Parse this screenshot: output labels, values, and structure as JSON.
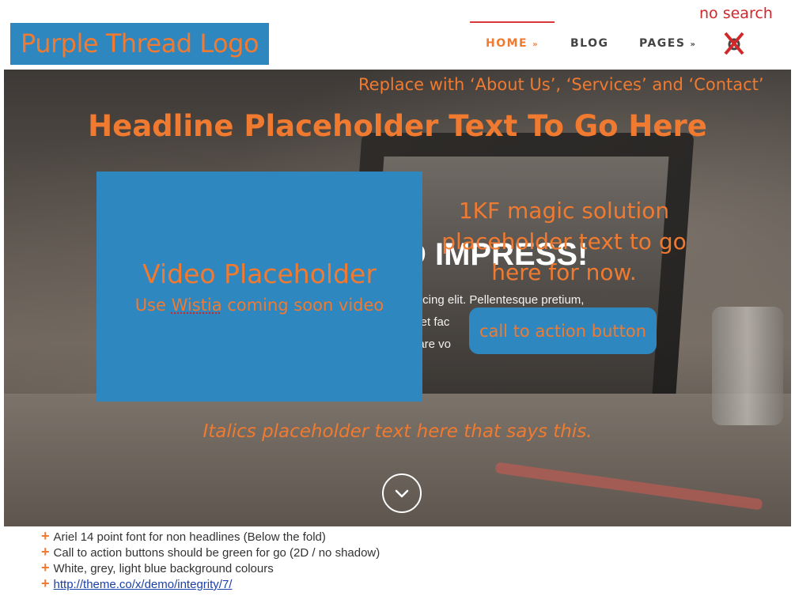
{
  "header": {
    "logo_text": "Purple Thread Logo",
    "nav": [
      {
        "label": "HOME",
        "chevron": "»",
        "active": true
      },
      {
        "label": "BLOG",
        "chevron": ""
      },
      {
        "label": "PAGES",
        "chevron": "»"
      }
    ],
    "search_note": "no search",
    "search_icon": "search-icon-crossed-out"
  },
  "hero": {
    "replace_note": "Replace with ‘About Us’, ‘Services’ and ‘Contact’",
    "headline": "Headline Placeholder Text To Go Here",
    "impress_text": "D IMPRESS!",
    "body_lines": [
      "piscing elit. Pellentesque pretium,",
      "eget fac",
      "rnare vo"
    ],
    "magic_lines": [
      "1KF magic solution",
      "placeholder text to go",
      "here for now."
    ],
    "video": {
      "title": "Video Placeholder",
      "sub_prefix": "Use ",
      "sub_link": "Wistia",
      "sub_suffix": " coming soon video"
    },
    "cta_label": "call to action button",
    "italics_text": "Italics placeholder text here that says this."
  },
  "notes": [
    "Ariel 14 point font for non headlines (Below the fold)",
    "Call to action buttons should be green for go (2D / no shadow)",
    "White, grey, light blue background colours"
  ],
  "notes_link": "http://theme.co/x/demo/integrity/7/",
  "colors": {
    "accent_orange": "#f07a30",
    "block_blue": "#2f87c0",
    "alert_red": "#d0282a"
  }
}
